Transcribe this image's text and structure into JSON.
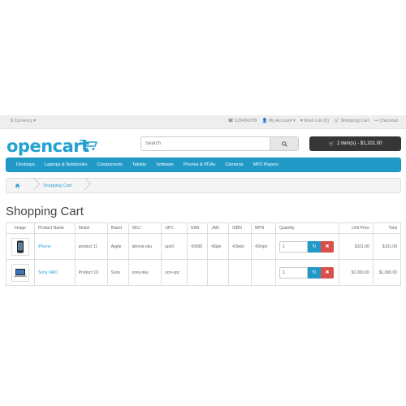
{
  "topbar": {
    "currency": "$ Currency ▾",
    "phone": "123456789",
    "account": "My Account ▾",
    "wishlist": "Wish List (0)",
    "cart": "Shopping Cart",
    "checkout": "Checkout"
  },
  "header": {
    "logo": "opencart",
    "search_placeholder": "Search",
    "cart_button": "2 item(s) - $1,101.00"
  },
  "menu": [
    "Desktops",
    "Laptops & Notebooks",
    "Components",
    "Tablets",
    "Software",
    "Phones & PDAs",
    "Cameras",
    "MP3 Players"
  ],
  "breadcrumb": {
    "current": "Shopping Cart"
  },
  "page_title": "Shopping Cart",
  "table": {
    "headers": [
      "Image",
      "Product Name",
      "Model",
      "Brand",
      "SKU",
      "UPC",
      "EAN",
      "JAN",
      "ISBN",
      "MPN",
      "Quantity",
      "Unit Price",
      "Total"
    ],
    "rows": [
      {
        "name": "iPhone",
        "model": "product 11",
        "brand": "Apple",
        "sku": "iphone-sku",
        "upc": "upc0",
        "ean": "43560",
        "jan": "43jan",
        "isbn": "43isbn",
        "mpn": "43mpn",
        "qty": "1",
        "unit": "$101.00",
        "total": "$101.00",
        "image": "phone-icon"
      },
      {
        "name": "Sony VAIO",
        "model": "Product 19",
        "brand": "Sony",
        "sku": "sony-sku",
        "upc": "son-upc",
        "ean": "",
        "jan": "",
        "isbn": "",
        "mpn": "",
        "qty": "1",
        "unit": "$1,000.00",
        "total": "$1,000.00",
        "image": "laptop-icon"
      }
    ]
  },
  "colors": {
    "accent": "#229ac8",
    "link": "#23a1d1",
    "cart_button_bg": "#363636",
    "remove_button": "#da4f49"
  }
}
